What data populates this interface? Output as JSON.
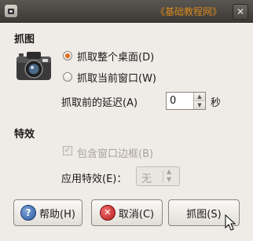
{
  "window": {
    "title": "《基础教程网》",
    "close_glyph": "✕",
    "app_icon": "camera-icon"
  },
  "grab_section": {
    "title": "抓图",
    "option_desktop": "抓取整个桌面(D)",
    "option_window": "抓取当前窗口(W)",
    "selected": "desktop",
    "delay_label": "抓取前的延迟(A)",
    "delay_value": "0",
    "delay_unit": "秒"
  },
  "effects_section": {
    "title": "特效",
    "border_checkbox_label": "包含窗口边框(B)",
    "border_checked": true,
    "apply_effect_label": "应用特效(E)：",
    "apply_effect_value": "无"
  },
  "buttons": {
    "help": "帮助(H)",
    "cancel": "取消(C)",
    "grab": "抓图(S)"
  },
  "icons": {
    "help_glyph": "?",
    "cancel_glyph": "✕",
    "spin_up": "▲",
    "spin_down": "▼",
    "combo_up": "▲",
    "combo_down": "▼",
    "check_glyph": "✓"
  }
}
